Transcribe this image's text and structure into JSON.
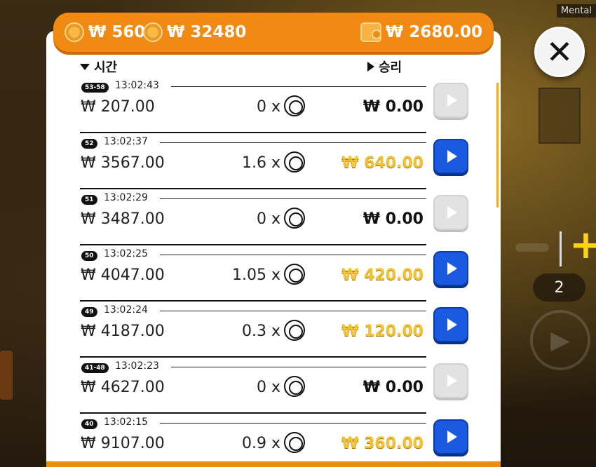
{
  "overlay_label": "Mental",
  "topbar": {
    "coin1_icon": "coin-icon",
    "coin1_value": "₩ 560",
    "coin2_icon": "coin-stack-icon",
    "coin2_value": "₩ 32480",
    "wallet_icon": "wallet-icon",
    "wallet_value": "₩ 2680.00"
  },
  "header": {
    "time_label": "시간",
    "win_label": "승리"
  },
  "close_icon": "close-icon",
  "background_controls": {
    "count": "2"
  },
  "rows": [
    {
      "badge": "53-58",
      "time": "13:02:43",
      "bet": "₩ 207.00",
      "multiplier": "0 x",
      "win": "₩ 0.00",
      "win_style": "zero",
      "replay": "inactive"
    },
    {
      "badge": "52",
      "time": "13:02:37",
      "bet": "₩ 3567.00",
      "multiplier": "1.6 x",
      "win": "₩ 640.00",
      "win_style": "gold",
      "replay": "active"
    },
    {
      "badge": "51",
      "time": "13:02:29",
      "bet": "₩ 3487.00",
      "multiplier": "0 x",
      "win": "₩ 0.00",
      "win_style": "zero",
      "replay": "inactive"
    },
    {
      "badge": "50",
      "time": "13:02:25",
      "bet": "₩ 4047.00",
      "multiplier": "1.05 x",
      "win": "₩ 420.00",
      "win_style": "gold",
      "replay": "active"
    },
    {
      "badge": "49",
      "time": "13:02:24",
      "bet": "₩ 4187.00",
      "multiplier": "0.3 x",
      "win": "₩ 120.00",
      "win_style": "gold",
      "replay": "active"
    },
    {
      "badge": "41-48",
      "time": "13:02:23",
      "bet": "₩ 4627.00",
      "multiplier": "0 x",
      "win": "₩ 0.00",
      "win_style": "zero",
      "replay": "inactive"
    },
    {
      "badge": "40",
      "time": "13:02:15",
      "bet": "₩ 9107.00",
      "multiplier": "0.9 x",
      "win": "₩ 360.00",
      "win_style": "gold",
      "replay": "active"
    }
  ]
}
